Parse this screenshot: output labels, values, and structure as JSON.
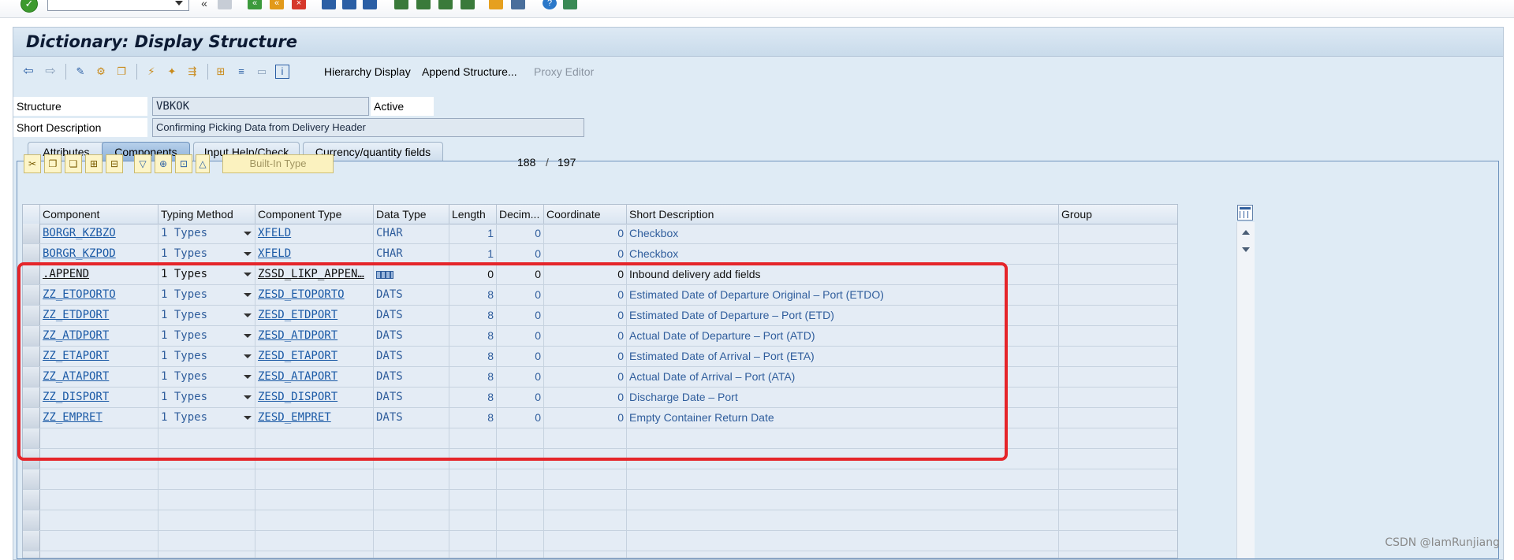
{
  "window": {
    "title": "Dictionary: Display Structure"
  },
  "toolbar": {
    "hierarchy_label": "Hierarchy Display",
    "append_label": "Append Structure...",
    "proxy_label": "Proxy Editor"
  },
  "header": {
    "structure_label": "Structure",
    "structure_value": "VBKOK",
    "status": "Active",
    "desc_label": "Short Description",
    "desc_value": "Confirming Picking Data from Delivery Header"
  },
  "tabs": [
    {
      "label": "Attributes"
    },
    {
      "label": "Components"
    },
    {
      "label": "Input Help/Check"
    },
    {
      "label": "Currency/quantity fields"
    }
  ],
  "table_toolbar": {
    "builtin_label": "Built-In Type",
    "current": "188",
    "sep": "/",
    "total": "197"
  },
  "columns": [
    "Component",
    "Typing Method",
    "Component Type",
    "Data Type",
    "Length",
    "Decim...",
    "Coordinate",
    "Short Description",
    "Group"
  ],
  "rows": [
    {
      "component": "BORGR_KZBZO",
      "typing": "1 Types",
      "comp_type": "XFELD",
      "data_type": "CHAR",
      "length": "1",
      "decimals": "0",
      "coordinate": "0",
      "desc": "Checkbox"
    },
    {
      "component": "BORGR_KZPOD",
      "typing": "1 Types",
      "comp_type": "XFELD",
      "data_type": "CHAR",
      "length": "1",
      "decimals": "0",
      "coordinate": "0",
      "desc": "Checkbox"
    },
    {
      "component": ".APPEND",
      "typing": "1 Types",
      "comp_type": "ZSSD_LIKP_APPEN…",
      "data_type": "",
      "length": "0",
      "decimals": "0",
      "coordinate": "0",
      "desc": "Inbound delivery add fields"
    },
    {
      "component": "ZZ_ETOPORTO",
      "typing": "1 Types",
      "comp_type": "ZESD_ETOPORTO",
      "data_type": "DATS",
      "length": "8",
      "decimals": "0",
      "coordinate": "0",
      "desc": "Estimated Date of Departure Original – Port (ETDO)"
    },
    {
      "component": "ZZ_ETDPORT",
      "typing": "1 Types",
      "comp_type": "ZESD_ETDPORT",
      "data_type": "DATS",
      "length": "8",
      "decimals": "0",
      "coordinate": "0",
      "desc": "Estimated Date of Departure – Port (ETD)"
    },
    {
      "component": "ZZ_ATDPORT",
      "typing": "1 Types",
      "comp_type": "ZESD_ATDPORT",
      "data_type": "DATS",
      "length": "8",
      "decimals": "0",
      "coordinate": "0",
      "desc": "Actual Date of Departure – Port (ATD)"
    },
    {
      "component": "ZZ_ETAPORT",
      "typing": "1 Types",
      "comp_type": "ZESD_ETAPORT",
      "data_type": "DATS",
      "length": "8",
      "decimals": "0",
      "coordinate": "0",
      "desc": "Estimated Date of Arrival – Port (ETA)"
    },
    {
      "component": "ZZ_ATAPORT",
      "typing": "1 Types",
      "comp_type": "ZESD_ATAPORT",
      "data_type": "DATS",
      "length": "8",
      "decimals": "0",
      "coordinate": "0",
      "desc": "Actual Date of Arrival – Port (ATA)"
    },
    {
      "component": "ZZ_DISPORT",
      "typing": "1 Types",
      "comp_type": "ZESD_DISPORT",
      "data_type": "DATS",
      "length": "8",
      "decimals": "0",
      "coordinate": "0",
      "desc": "Discharge Date – Port"
    },
    {
      "component": "ZZ_EMPRET",
      "typing": "1 Types",
      "comp_type": "ZESD_EMPRET",
      "data_type": "DATS",
      "length": "8",
      "decimals": "0",
      "coordinate": "0",
      "desc": "Empty Container Return Date"
    }
  ],
  "watermark": "CSDN @IamRunjiang"
}
